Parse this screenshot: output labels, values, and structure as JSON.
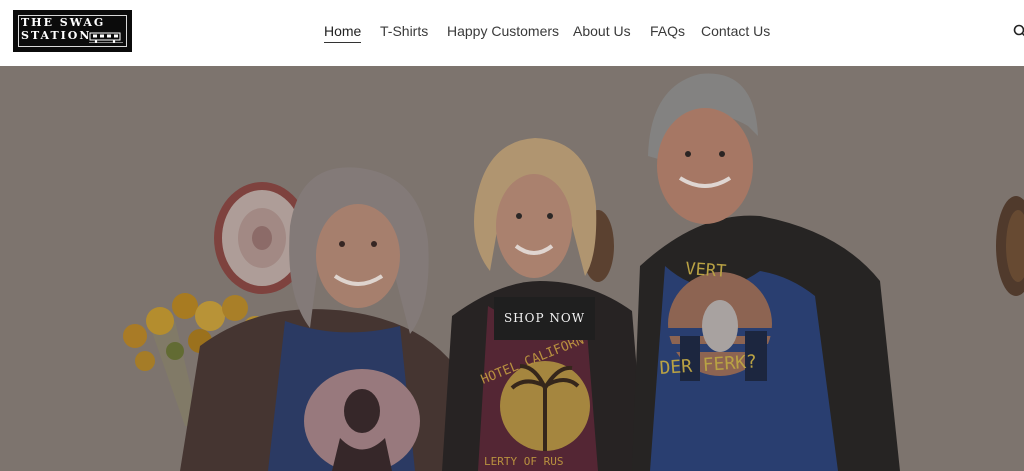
{
  "brand": {
    "logo_line1": "THE SWAG",
    "logo_line2": "STATION"
  },
  "nav": {
    "items": [
      {
        "label": "Home",
        "active": true
      },
      {
        "label": "T-Shirts",
        "active": false
      },
      {
        "label": "Happy Customers",
        "active": false
      },
      {
        "label": "About Us",
        "active": false
      },
      {
        "label": "FAQs",
        "active": false
      },
      {
        "label": "Contact Us",
        "active": false
      }
    ]
  },
  "hero": {
    "cta_label": "SHOP NOW",
    "shirt_texts": {
      "left_shirt": "HOTEL CALIFORN",
      "left_shirt_bottom": "LERTY OF RUS",
      "right_shirt_top": "VERT",
      "right_shirt_bottom": "DER FERK?"
    }
  },
  "icons": {
    "search": "search-icon",
    "logo_train": "train-icon"
  },
  "colors": {
    "header_bg": "#ffffff",
    "cta_bg": "#1f1f1f",
    "hero_overlay": "#8a7f79"
  }
}
